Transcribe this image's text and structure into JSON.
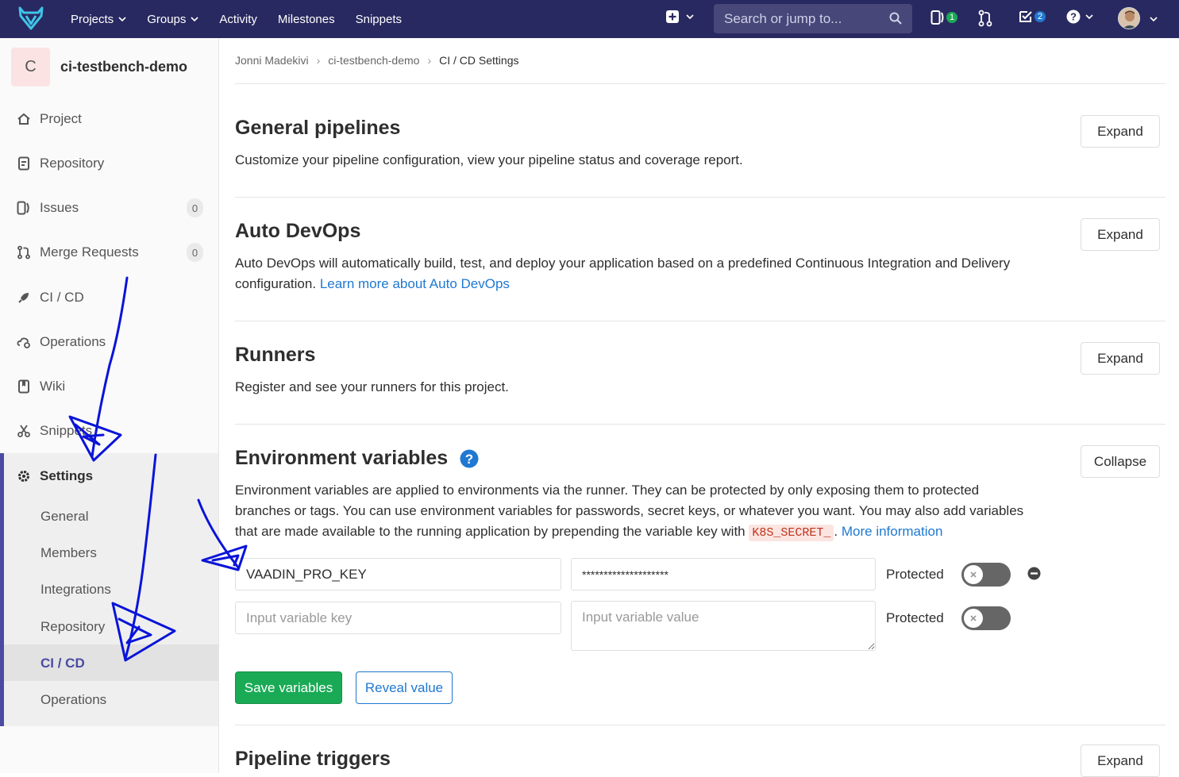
{
  "colors": {
    "navbar": "#292961",
    "accent": "#4b4ba3",
    "link": "#1f78d1",
    "success": "#1aaa55",
    "annotation": "#0a14d8"
  },
  "navbar": {
    "logo_icon": "gitlab-tanuki-icon",
    "links": [
      {
        "label": "Projects",
        "dropdown": true
      },
      {
        "label": "Groups",
        "dropdown": true
      },
      {
        "label": "Activity"
      },
      {
        "label": "Milestones"
      },
      {
        "label": "Snippets"
      }
    ],
    "search_placeholder": "Search or jump to...",
    "issues_count": "1",
    "todos_count": "2"
  },
  "sidebar": {
    "project_initial": "C",
    "project_name": "ci-testbench-demo",
    "items": [
      {
        "label": "Project",
        "icon": "home-icon"
      },
      {
        "label": "Repository",
        "icon": "doc-icon"
      },
      {
        "label": "Issues",
        "icon": "issues-icon",
        "count": "0"
      },
      {
        "label": "Merge Requests",
        "icon": "merge-request-icon",
        "count": "0"
      },
      {
        "label": "CI / CD",
        "icon": "rocket-icon"
      },
      {
        "label": "Operations",
        "icon": "cloud-gear-icon"
      },
      {
        "label": "Wiki",
        "icon": "book-icon"
      },
      {
        "label": "Snippets",
        "icon": "scissors-icon"
      }
    ],
    "settings": {
      "label": "Settings",
      "icon": "gear-icon",
      "sub_items": [
        "General",
        "Members",
        "Integrations",
        "Repository",
        "CI / CD",
        "Operations"
      ],
      "active": "CI / CD"
    }
  },
  "breadcrumb": [
    "Jonni Madekivi",
    "ci-testbench-demo",
    "CI / CD Settings"
  ],
  "sections": {
    "general": {
      "title": "General pipelines",
      "desc": "Customize your pipeline configuration, view your pipeline status and coverage report.",
      "button": "Expand"
    },
    "autodevops": {
      "title": "Auto DevOps",
      "desc": "Auto DevOps will automatically build, test, and deploy your application based on a predefined Continuous Integration and Delivery configuration.",
      "link": "Learn more about Auto DevOps",
      "button": "Expand"
    },
    "runners": {
      "title": "Runners",
      "desc": "Register and see your runners for this project.",
      "button": "Expand"
    },
    "envvars": {
      "title": "Environment variables",
      "desc_before": "Environment variables are applied to environments via the runner. They can be protected by only exposing them to protected branches or tags. You can use environment variables for passwords, secret keys, or whatever you want. You may also add variables that are made available to the running application by prepending the variable key with",
      "code": "K8S_SECRET_",
      "desc_after": ".",
      "link": "More information",
      "button": "Collapse",
      "rows": [
        {
          "key": "VAADIN_PRO_KEY",
          "value": "********************",
          "protected_label": "Protected"
        },
        {
          "key_placeholder": "Input variable key",
          "value_placeholder": "Input variable value",
          "protected_label": "Protected"
        }
      ],
      "save_label": "Save variables",
      "reveal_label": "Reveal value"
    },
    "triggers": {
      "title": "Pipeline triggers",
      "button": "Expand"
    }
  }
}
